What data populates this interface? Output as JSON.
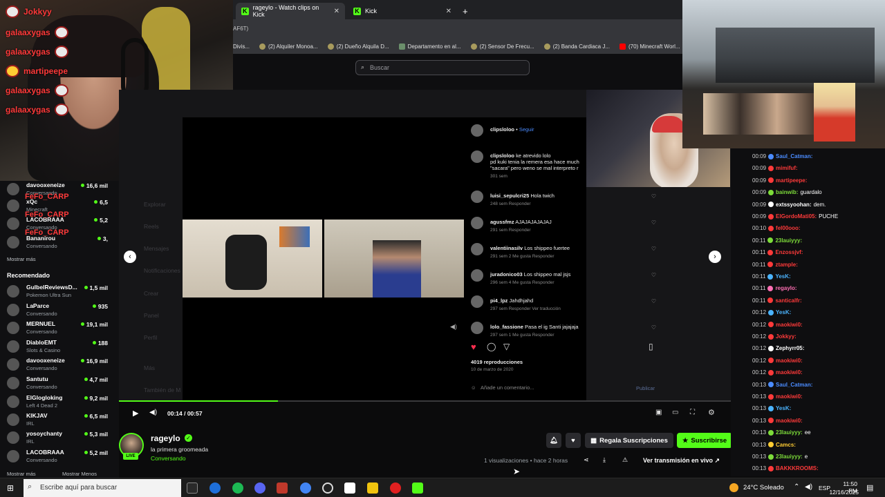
{
  "webcam_overlay": {
    "names": [
      "Jokkyy",
      "galaaxygas",
      "galaaxygas",
      "martipeepe",
      "galaaxygas",
      "galaaxygas"
    ]
  },
  "browser": {
    "tabs": [
      {
        "label": "rageylo - Watch clips on Kick",
        "active": true
      },
      {
        "label": "Kick",
        "active": false
      }
    ],
    "new_tab": "+",
    "url_fragment": "AF6T)",
    "bookmarks": [
      "Divis...",
      "(2) Alquiler Monoa...",
      "(2) Dueño Alquila D...",
      "Departamento en al...",
      "(2) Sensor De Frecu...",
      "(2) Banda Cardiaca J...",
      "(70) Minecraft Worl..."
    ],
    "search_placeholder": "Buscar"
  },
  "kick_nav": [
    "Explorar",
    "Reels",
    "Mensajes",
    "Notificaciones",
    "Crear",
    "Panel",
    "Perfil",
    "Más",
    "También de M"
  ],
  "sidebar": {
    "channels_top": [
      {
        "name": "davooxeneize",
        "sub": "Conversando",
        "viewers": "16,6 mil"
      },
      {
        "name": "xQc",
        "sub": "Minecraft",
        "viewers": "6,5"
      },
      {
        "name": "LACOBRAAA",
        "sub": "Conversando",
        "viewers": "5,2"
      },
      {
        "name": "Bananirou",
        "sub": "Conversando",
        "viewers": "3,"
      }
    ],
    "show_more": "Mostrar más",
    "recommended_title": "Recomendado",
    "recommended": [
      {
        "name": "GulbelReviewsD...",
        "sub": "Pokemon Ultra Sun",
        "viewers": "1,5 mil"
      },
      {
        "name": "LaParce",
        "sub": "Conversando",
        "viewers": "935"
      },
      {
        "name": "MERNUEL",
        "sub": "Conversando",
        "viewers": "19,1 mil"
      },
      {
        "name": "DiabloEMT",
        "sub": "Slots & Casino",
        "viewers": "188"
      },
      {
        "name": "davooxeneize",
        "sub": "Conversando",
        "viewers": "16,9 mil"
      },
      {
        "name": "Santutu",
        "sub": "Conversando",
        "viewers": "4,7 mil"
      },
      {
        "name": "ElGlogloking",
        "sub": "Left 4 Dead 2",
        "viewers": "9,2 mil"
      },
      {
        "name": "KIKJAV",
        "sub": "IRL",
        "viewers": "6,5 mil"
      },
      {
        "name": "yosoychanty",
        "sub": "IRL",
        "viewers": "5,3 mil"
      },
      {
        "name": "LACOBRAAA",
        "sub": "Conversando",
        "viewers": "5,2 mil"
      }
    ],
    "show_more_bottom": "Mostrar más",
    "show_less": "Mostrar Menos",
    "overlay_names": [
      "FeFo_CARP",
      "FeFo_CARP",
      "FeFo_CARP"
    ]
  },
  "instagram": {
    "author": "clipsloloo",
    "follow": "Seguir",
    "caption_user": "clipsloloo",
    "caption": "ke atrevido lolo",
    "caption2": "pd kuki tenia la remera esa hace much",
    "caption3": "\"sacara\" pero weno se mal interpreto r",
    "caption_meta": "301 sem",
    "comments": [
      {
        "user": "luisi_sepulcri25",
        "text": "Hola twich",
        "meta": "248 sem   Responder"
      },
      {
        "user": "agussfmz",
        "text": "AJAJAJAJAJAJ",
        "meta": "291 sem   Responder"
      },
      {
        "user": "valentiinasilv",
        "text": "Los shippeo fuertee",
        "meta": "291 sem   2 Me gusta   Responder"
      },
      {
        "user": "juradonico03",
        "text": "Los shippeo mal jsjs",
        "meta": "296 sem   4 Me gusta   Responder"
      },
      {
        "user": "pi4_lpz",
        "text": "Jahdhjahd",
        "meta": "297 sem   Responder   Ver traducción"
      },
      {
        "user": "lolo_fassione",
        "text": "Pasa el ig Santi jajajaja",
        "meta": "297 sem   1 Me gusta   Responder"
      }
    ],
    "views": "4019 reproducciones",
    "date": "10 de marzo de 2020",
    "comment_placeholder": "Añade un comentario...",
    "publish": "Publicar"
  },
  "player": {
    "time": "00:14 / 00:57",
    "progress": 0.26
  },
  "channel": {
    "name": "rageylo",
    "title": "la primera groomeada",
    "category": "Conversando",
    "live": "LIVE",
    "gift_button": "Regala Suscripciones",
    "subscribe_button": "Suscribirse",
    "views_text": "1 visualizaciones",
    "time_ago": "• hace 2 horas",
    "live_link": "Ver transmisión en vivo"
  },
  "chat": [
    {
      "time": "00:09",
      "user": "Saul_Catman:",
      "text": "",
      "color": "#4b8cff"
    },
    {
      "time": "00:09",
      "user": "mimifuf:",
      "text": "",
      "color": "#ff3a3a"
    },
    {
      "time": "00:09",
      "user": "martipeepe:",
      "text": "",
      "color": "#ff3a3a"
    },
    {
      "time": "00:09",
      "user": "bainwib:",
      "text": "guardalo",
      "color": "#7ddc3a"
    },
    {
      "time": "00:09",
      "user": "extssyoohan:",
      "text": "dem.",
      "color": "#ffffff"
    },
    {
      "time": "00:09",
      "user": "ElGordoMati05:",
      "text": "PUCHE",
      "color": "#ff3a3a"
    },
    {
      "time": "00:10",
      "user": "fel00ooo:",
      "text": "",
      "color": "#ff3a3a"
    },
    {
      "time": "00:11",
      "user": "23lauiyyy:",
      "text": "",
      "color": "#7ddc3a"
    },
    {
      "time": "00:11",
      "user": "Enzossjvf:",
      "text": "",
      "color": "#ff3a3a"
    },
    {
      "time": "00:11",
      "user": "ztample:",
      "text": "",
      "color": "#ff3a3a"
    },
    {
      "time": "00:11",
      "user": "YesK:",
      "text": "",
      "color": "#4bb4ff"
    },
    {
      "time": "00:11",
      "user": "regaylo:",
      "text": "",
      "color": "#ff6fb4"
    },
    {
      "time": "00:11",
      "user": "santicalfr:",
      "text": "",
      "color": "#ff3a3a"
    },
    {
      "time": "00:12",
      "user": "YesK:",
      "text": "",
      "color": "#4bb4ff"
    },
    {
      "time": "00:12",
      "user": "maokiwi0:",
      "text": "",
      "color": "#ff3a3a"
    },
    {
      "time": "00:12",
      "user": "Jokkyy:",
      "text": "",
      "color": "#ff3a3a"
    },
    {
      "time": "00:12",
      "user": "Zephyrr05:",
      "text": "",
      "color": "#ffffff"
    },
    {
      "time": "00:12",
      "user": "maokiwi0:",
      "text": "",
      "color": "#ff3a3a"
    },
    {
      "time": "00:12",
      "user": "maokiwi0:",
      "text": "",
      "color": "#ff3a3a"
    },
    {
      "time": "00:13",
      "user": "Saul_Catman:",
      "text": "",
      "color": "#4b8cff"
    },
    {
      "time": "00:13",
      "user": "maokiwi0:",
      "text": "",
      "color": "#ff3a3a"
    },
    {
      "time": "00:13",
      "user": "YesK:",
      "text": "",
      "color": "#4bb4ff"
    },
    {
      "time": "00:13",
      "user": "maokiwi0:",
      "text": "",
      "color": "#ff3a3a"
    },
    {
      "time": "00:13",
      "user": "23lauiyyy:",
      "text": "ee",
      "color": "#7ddc3a"
    },
    {
      "time": "00:13",
      "user": "Camcs:",
      "text": "",
      "color": "#ffcc33"
    },
    {
      "time": "00:13",
      "user": "23lauiyyy:",
      "text": "e",
      "color": "#7ddc3a"
    },
    {
      "time": "00:13",
      "user": "BAKKKROOMS:",
      "text": "",
      "color": "#ff3a3a"
    }
  ],
  "taskbar": {
    "search_placeholder": "Escribe aquí para buscar",
    "weather": "24°C  Soleado",
    "language": "ESP",
    "time": "11:50 PM",
    "date": "12/16/2025"
  },
  "colors": {
    "kick_green": "#53fc18",
    "background": "#0b0b0c",
    "chat_red": "#ff3a3a"
  }
}
